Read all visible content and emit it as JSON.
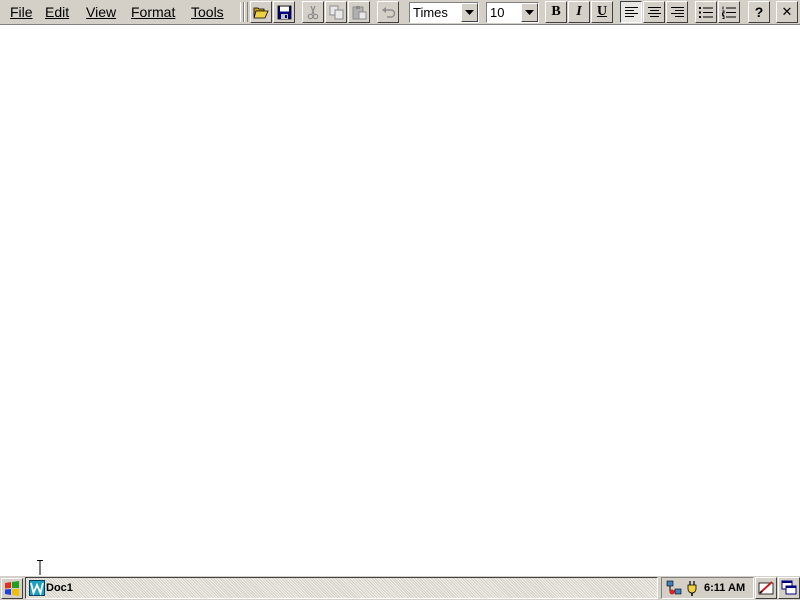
{
  "menu": {
    "file": "File",
    "edit": "Edit",
    "view": "View",
    "format": "Format",
    "tools": "Tools"
  },
  "toolbar": {
    "open_icon": "open-folder-icon",
    "save_icon": "save-disk-icon",
    "cut_icon": "cut-icon",
    "copy_icon": "copy-icon",
    "paste_icon": "paste-icon",
    "undo_icon": "undo-icon",
    "font_name": "Times",
    "font_size": "10",
    "bold_label": "B",
    "italic_label": "I",
    "underline_label": "U",
    "align_left_active": true,
    "help_label": "?",
    "close_label": "✕"
  },
  "taskbar": {
    "task_label": "Doc1",
    "clock": "6:11 AM"
  },
  "colors": {
    "face": "#d4d0c8",
    "document": "#ffffff",
    "highlight": "#ffffff",
    "shadow": "#808080",
    "disabled": "#8c8c8c"
  }
}
